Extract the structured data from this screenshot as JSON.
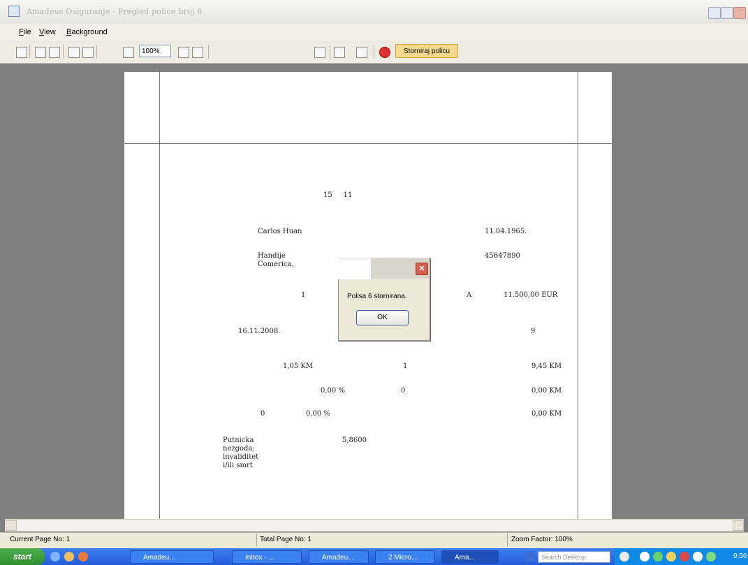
{
  "window": {
    "title": "Amadeus Osiguranje - Pregled police broj 6"
  },
  "menu": {
    "items": [
      {
        "key": "F",
        "rest": "ile"
      },
      {
        "key": "V",
        "rest": "iew"
      },
      {
        "key": "B",
        "rest": "ackground"
      }
    ]
  },
  "toolbar": {
    "zoom_value": "100%",
    "storniraj_label": "Storniraj policu"
  },
  "document": {
    "page_header": "15     11",
    "name": "Carlos Huan",
    "birth_date": "11.04.1965.",
    "address_line1": "Handije",
    "address_line2": "Comerica,",
    "id_number": "45647890",
    "col_1": "1",
    "col_A": "A",
    "amount_eur": "11.500,00 EUR",
    "date": "16.11.2008.",
    "days": "9",
    "rate_km": "1,05 KM",
    "rate_count": "1",
    "rate_total": "9,45 KM",
    "pct1": "0,00 %",
    "pct1_count": "0",
    "pct1_total": "0,00 KM",
    "pct2_count": "0",
    "pct2": "0,00 %",
    "pct2_total": "0,00 KM",
    "coverage_text": "Putnicka nezgoda: invaliditet i/ili smrt",
    "coefficient": "5,8600"
  },
  "dialog": {
    "message": "Polisa 6 stornirana.",
    "ok_label": "OK",
    "close_glyph": "✕"
  },
  "status": {
    "current_page": "Current Page No: 1",
    "total_page": "Total Page No: 1",
    "zoom_factor": "Zoom Factor: 100%"
  },
  "taskbar": {
    "start_label": "start",
    "tasks": [
      "Amadeu...",
      "Inbox - ...",
      "Amadeu...",
      "2 Micro...",
      "Ama..."
    ],
    "search_placeholder": "Search Desktop",
    "clock": "9:56"
  },
  "colors": {
    "workspace": "#808080",
    "dialog_close": "#d85d4e",
    "storniraj_bg": "#f5d98a",
    "taskbar": "#245edb"
  }
}
